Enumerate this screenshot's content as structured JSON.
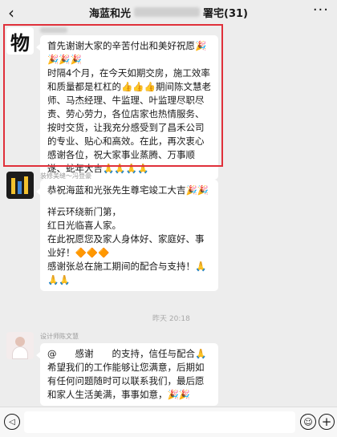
{
  "header": {
    "title_start": "海蓝和光",
    "title_end": "署宅(31)",
    "back_icon": "chevron-left-icon",
    "more_icon": "more-dots-icon"
  },
  "messages": [
    {
      "avatar_text": "物",
      "paragraphs": [
        "首先谢谢大家的辛苦付出和美好祝愿🎉🎉🎉🎉",
        "时隔4个月，在今天如期交房，施工效率和质量都是杠杠的👍👍👍期间陈文慧老师、马杰经理、牛监理、叶监理尽职尽责、劳心劳力，各位店家也热情服务、按时交货，让我充分感受到了昌禾公司的专业、贴心和高效。在此，再次衷心感谢各位，祝大家事业蒸腾、万事顺遂、蛇年大吉🙏🙏🙏🙏"
      ]
    },
    {
      "sender": "装修美缝～冯登豪",
      "paragraphs": [
        "恭祝海蓝和光张先生尊宅竣工大吉🎉🎉",
        "",
        "祥云环绕新门第，",
        "红日光临喜人家。",
        "在此祝愿您及家人身体好、家庭好、事业好！🔶🔶🔶",
        "感谢张总在施工期间的配合与支持！🙏🙏🙏"
      ]
    },
    {
      "sender": "设计师陈文慧",
      "paragraphs": [
        "@　　感谢　　的支持，信任与配合🙏希望我们的工作能够让您满意，后期如有任何问题随时可以联系我们，最后愿　　和家人生活美满，事事如意，🎉🎉"
      ]
    }
  ],
  "timestamp": "昨天 20:18",
  "input": {
    "voice_icon": "voice-icon",
    "emoji_icon": "emoji-icon",
    "plus_icon": "plus-icon"
  }
}
